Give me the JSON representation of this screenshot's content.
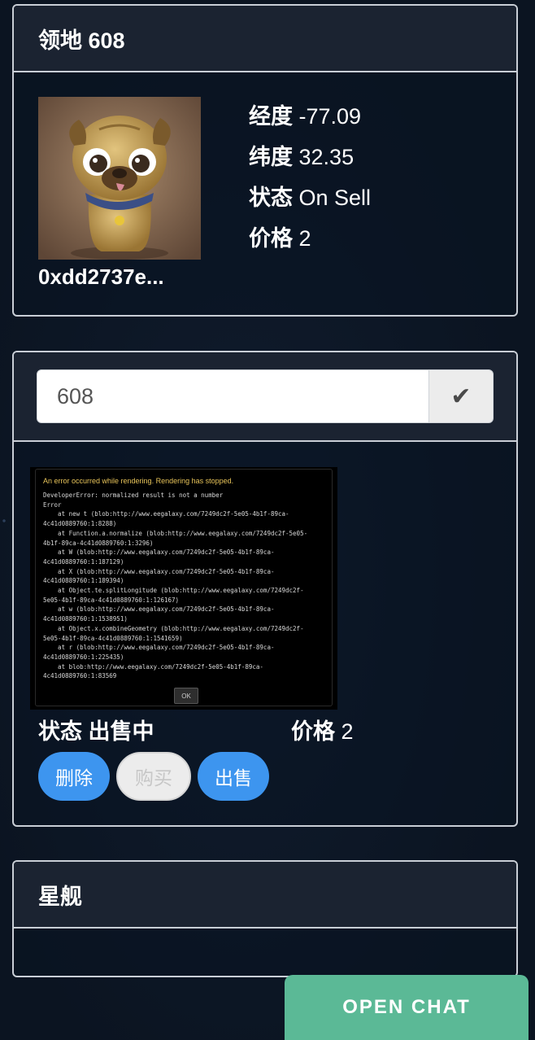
{
  "land_panel": {
    "title": "领地 608",
    "owner": "0xdd2737e...",
    "longitude": {
      "label": "经度",
      "value": "-77.09"
    },
    "latitude": {
      "label": "纬度",
      "value": "32.35"
    },
    "status": {
      "label": "状态",
      "value": "On Sell"
    },
    "price": {
      "label": "价格",
      "value": "2"
    }
  },
  "search_panel": {
    "input_value": "608",
    "submit_icon": "check-icon",
    "error_image": {
      "header": "An error occurred while rendering. Rendering has stopped.",
      "body": "DeveloperError: normalized result is not a number\nError\n    at new t (blob:http://www.eegalaxy.com/7249dc2f-5e05-4b1f-89ca-\n4c41d0889760:1:8288)\n    at Function.a.normalize (blob:http://www.eegalaxy.com/7249dc2f-5e05-\n4b1f-89ca-4c41d0889760:1:3296)\n    at W (blob:http://www.eegalaxy.com/7249dc2f-5e05-4b1f-89ca-\n4c41d0889760:1:187129)\n    at X (blob:http://www.eegalaxy.com/7249dc2f-5e05-4b1f-89ca-\n4c41d0889760:1:189394)\n    at Object.te.splitLongitude (blob:http://www.eegalaxy.com/7249dc2f-\n5e05-4b1f-89ca-4c41d0889760:1:126167)\n    at w (blob:http://www.eegalaxy.com/7249dc2f-5e05-4b1f-89ca-\n4c41d0889760:1:1538951)\n    at Object.x.combineGeometry (blob:http://www.eegalaxy.com/7249dc2f-\n5e05-4b1f-89ca-4c41d0889760:1:1541659)\n    at r (blob:http://www.eegalaxy.com/7249dc2f-5e05-4b1f-89ca-\n4c41d0889760:1:225435)\n    at blob:http://www.eegalaxy.com/7249dc2f-5e05-4b1f-89ca-\n4c41d0889760:1:83569",
      "ok_label": "OK"
    },
    "status": {
      "label": "状态",
      "value": "出售中"
    },
    "price": {
      "label": "价格",
      "value": "2"
    },
    "buttons": {
      "delete": "删除",
      "buy": "购买",
      "sell": "出售"
    }
  },
  "ship_panel": {
    "title": "星舰"
  },
  "chat": {
    "label": "OPEN CHAT"
  },
  "colors": {
    "accent_blue": "#3d95ef",
    "chat_green": "#5bb996",
    "background": "#0b1421"
  }
}
